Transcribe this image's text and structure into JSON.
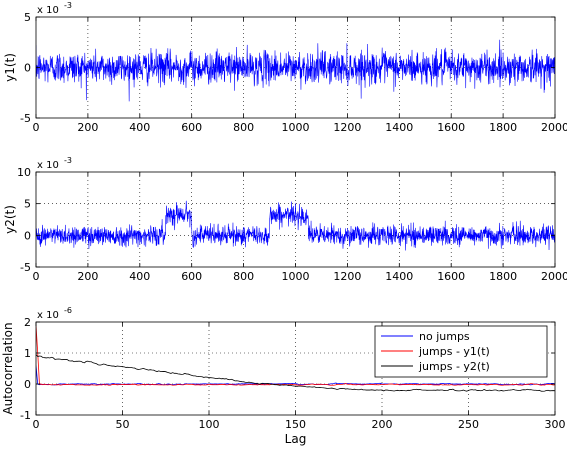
{
  "chart_data": [
    {
      "type": "line",
      "ylabel": "y1(t)",
      "xlabel": "",
      "y_multiplier_label": "x 10",
      "y_multiplier_exp": "-3",
      "xlim": [
        0,
        2000
      ],
      "ylim": [
        -5,
        5
      ],
      "x_ticks": [
        0,
        200,
        400,
        600,
        800,
        1000,
        1200,
        1400,
        1600,
        1800,
        2000
      ],
      "y_ticks": [
        -5,
        0,
        5
      ],
      "grid": true,
      "series": [
        {
          "color": "#0000ff",
          "n_points": 2000,
          "baseline": 0,
          "noise_std": 0.8,
          "spread": [
            -3.5,
            3.5
          ],
          "segments": []
        }
      ]
    },
    {
      "type": "line",
      "ylabel": "y2(t)",
      "xlabel": "",
      "y_multiplier_label": "x 10",
      "y_multiplier_exp": "-3",
      "xlim": [
        0,
        2000
      ],
      "ylim": [
        -5,
        10
      ],
      "x_ticks": [
        0,
        200,
        400,
        600,
        800,
        1000,
        1200,
        1400,
        1600,
        1800,
        2000
      ],
      "y_ticks": [
        -5,
        0,
        5,
        10
      ],
      "grid": true,
      "series": [
        {
          "color": "#0000ff",
          "n_points": 2000,
          "baseline": 0,
          "noise_std": 0.8,
          "spread": [
            -3.5,
            5.5
          ],
          "segments": [
            {
              "start": 500,
              "end": 600,
              "level": 3.4
            },
            {
              "start": 900,
              "end": 1050,
              "level": 3.2
            }
          ]
        }
      ]
    },
    {
      "type": "line",
      "ylabel": "Autocorrelation",
      "xlabel": "Lag",
      "y_multiplier_label": "x 10",
      "y_multiplier_exp": "-6",
      "xlim": [
        0,
        300
      ],
      "ylim": [
        -1,
        2
      ],
      "x_ticks": [
        0,
        50,
        100,
        150,
        200,
        250,
        300
      ],
      "y_ticks": [
        -1,
        0,
        1,
        2
      ],
      "grid": true,
      "legend": {
        "position": "top-right"
      },
      "series": [
        {
          "name": "no jumps",
          "color": "#0000ff",
          "lag0": 0.6,
          "values_approx": {
            "start": 0.0,
            "end": 0.0
          },
          "noise": 0.02
        },
        {
          "name": "jumps - y1(t)",
          "color": "#ff0000",
          "lag0": 1.9,
          "values_approx": {
            "start": 1.0,
            "end": -0.02
          },
          "noise": 0.02
        },
        {
          "name": "jumps - y2(t)",
          "color": "#000000",
          "lag0": 0.95,
          "values_approx": {
            "start": 0.9,
            "cross_zero_lag": 130,
            "end": -0.2
          },
          "noise": 0.03
        }
      ]
    }
  ]
}
